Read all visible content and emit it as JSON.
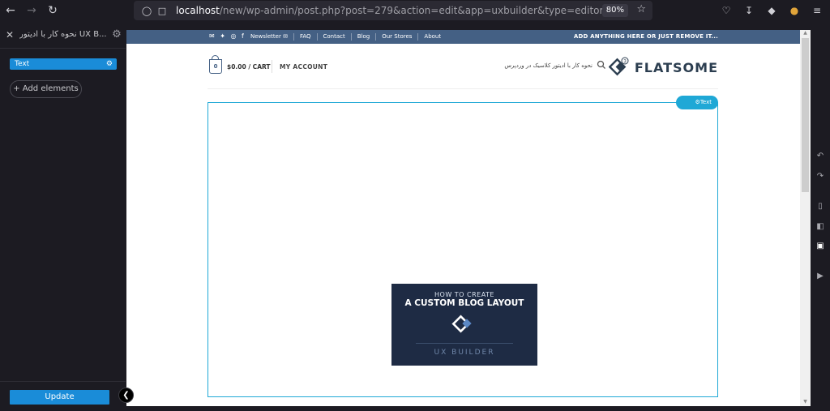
{
  "browser": {
    "url_host": "localhost",
    "url_rest": "/new/wp-admin/post.php?post=279&action=edit&app=uxbuilder&type=editor#/",
    "zoom": "80%",
    "icons": [
      "back-icon",
      "forward-icon",
      "reload-icon",
      "shield-icon",
      "page-icon",
      "star-icon",
      "pocket-icon",
      "download-icon",
      "extension-icon",
      "color-icon",
      "menu-icon"
    ]
  },
  "panel": {
    "title": "نحوه کار با ادیتور UX B...",
    "elements": [
      {
        "label": "Text"
      }
    ],
    "add_elements": "+ Add elements",
    "update": "Update"
  },
  "site": {
    "topbar": {
      "links": [
        "Newsletter ✉",
        "FAQ",
        "Contact",
        "Blog",
        "Our Stores",
        "About"
      ],
      "promo": "ADD ANYTHING HERE OR JUST REMOVE IT..."
    },
    "header": {
      "cart_count": "0",
      "cart_label": "$0.00 / CART",
      "account": "MY ACCOUNT",
      "search_text": "نحوه کار با ادیتور کلاسیک در وردپرس",
      "logo_text": "FLATSOME",
      "logo_badge": "3"
    },
    "content": {
      "element_tag": "Text",
      "banner": {
        "line1": "HOW TO CREATE",
        "line2": "A CUSTOM BLOG LAYOUT",
        "line3": "UX BUILDER"
      }
    }
  },
  "colors": {
    "accent": "#1a8cd8",
    "topbar": "#446084",
    "selection": "#1fa8d6",
    "banner_bg": "#1e2b44"
  }
}
